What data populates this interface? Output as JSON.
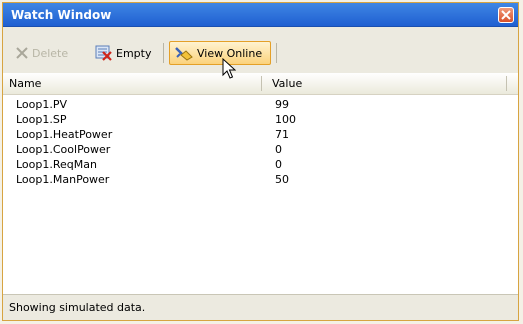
{
  "window": {
    "title": "Watch Window"
  },
  "toolbar": {
    "delete_label": "Delete",
    "empty_label": "Empty",
    "view_online_label": "View Online"
  },
  "grid": {
    "columns": [
      "Name",
      "Value"
    ],
    "rows": [
      {
        "name": "Loop1.PV",
        "value": "99"
      },
      {
        "name": "Loop1.SP",
        "value": "100"
      },
      {
        "name": "Loop1.HeatPower",
        "value": "71"
      },
      {
        "name": "Loop1.CoolPower",
        "value": "0"
      },
      {
        "name": "Loop1.ReqMan",
        "value": "0"
      },
      {
        "name": "Loop1.ManPower",
        "value": "50"
      }
    ]
  },
  "status": {
    "text": "Showing simulated data."
  },
  "colors": {
    "title_bar": "#1f5fd1",
    "hot_button": "#fbd27c",
    "close_button": "#d9502a"
  },
  "icons": {
    "delete": "x-icon",
    "empty": "empty-list-icon",
    "view_online": "view-online-icon",
    "close": "close-icon",
    "cursor": "mouse-pointer-icon"
  }
}
